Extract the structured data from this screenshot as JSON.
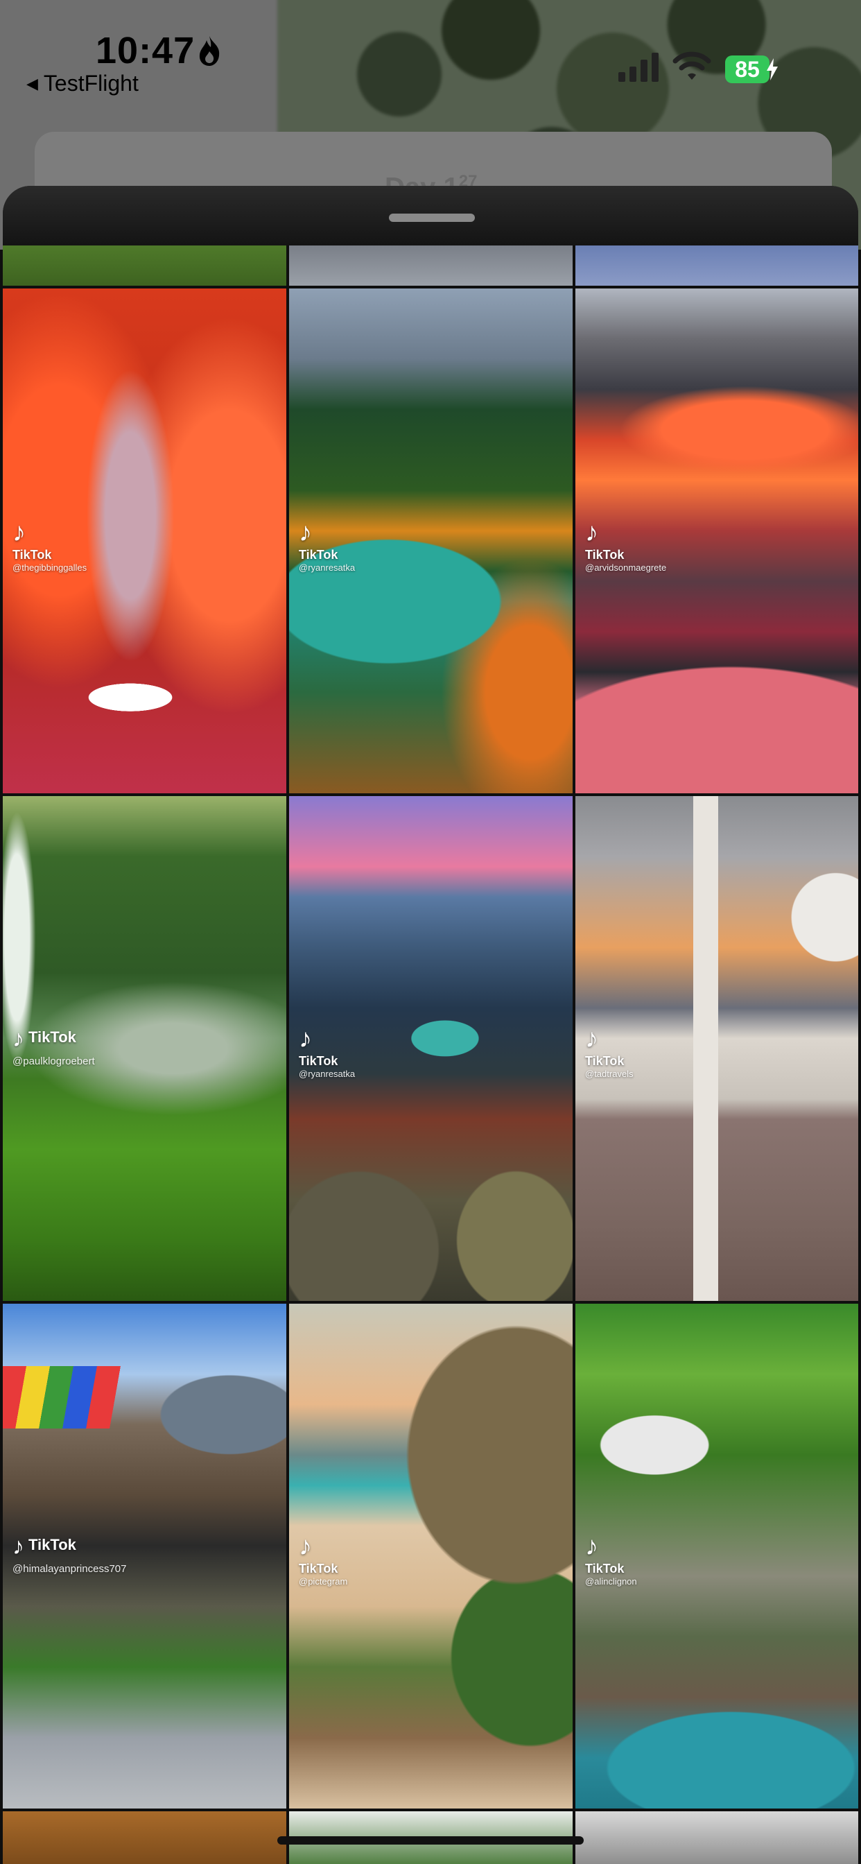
{
  "status_bar": {
    "time": "10:47",
    "back_app_label": "TestFlight",
    "battery_level": "85",
    "battery_color": "#34c759"
  },
  "background_app": {
    "title_partial": "Day 1",
    "count_partial": "27"
  },
  "icons": [
    "flame-icon",
    "signal-icon",
    "wifi-icon",
    "bolt-icon",
    "tiktok-note-icon",
    "back-triangle-icon"
  ],
  "grid": {
    "tiles": [
      {
        "row": "top-partial",
        "badge": "",
        "handle": ""
      },
      {
        "row": "top-partial",
        "badge": "",
        "handle": ""
      },
      {
        "row": "top-partial",
        "badge": "",
        "handle": ""
      },
      {
        "badge": "TikTok",
        "handle": "@thegibbinggalles"
      },
      {
        "badge": "TikTok",
        "handle": "@ryanresatka"
      },
      {
        "badge": "TikTok",
        "handle": "@arvidsonmaegrete"
      },
      {
        "badge": "TikTok",
        "handle": "@paulklogroebert"
      },
      {
        "badge": "TikTok",
        "handle": "@ryanresatka"
      },
      {
        "badge": "TikTok",
        "handle": "@tadtravels"
      },
      {
        "badge": "TikTok",
        "handle": "@himalayanprincess707"
      },
      {
        "badge": "TikTok",
        "handle": "@pictegram"
      },
      {
        "badge": "TikTok",
        "handle": "@alinclignon"
      },
      {
        "row": "bottom-partial",
        "badge": "",
        "handle": ""
      },
      {
        "row": "bottom-partial",
        "badge": "",
        "handle": ""
      },
      {
        "row": "bottom-partial",
        "badge": "",
        "handle": ""
      }
    ]
  }
}
